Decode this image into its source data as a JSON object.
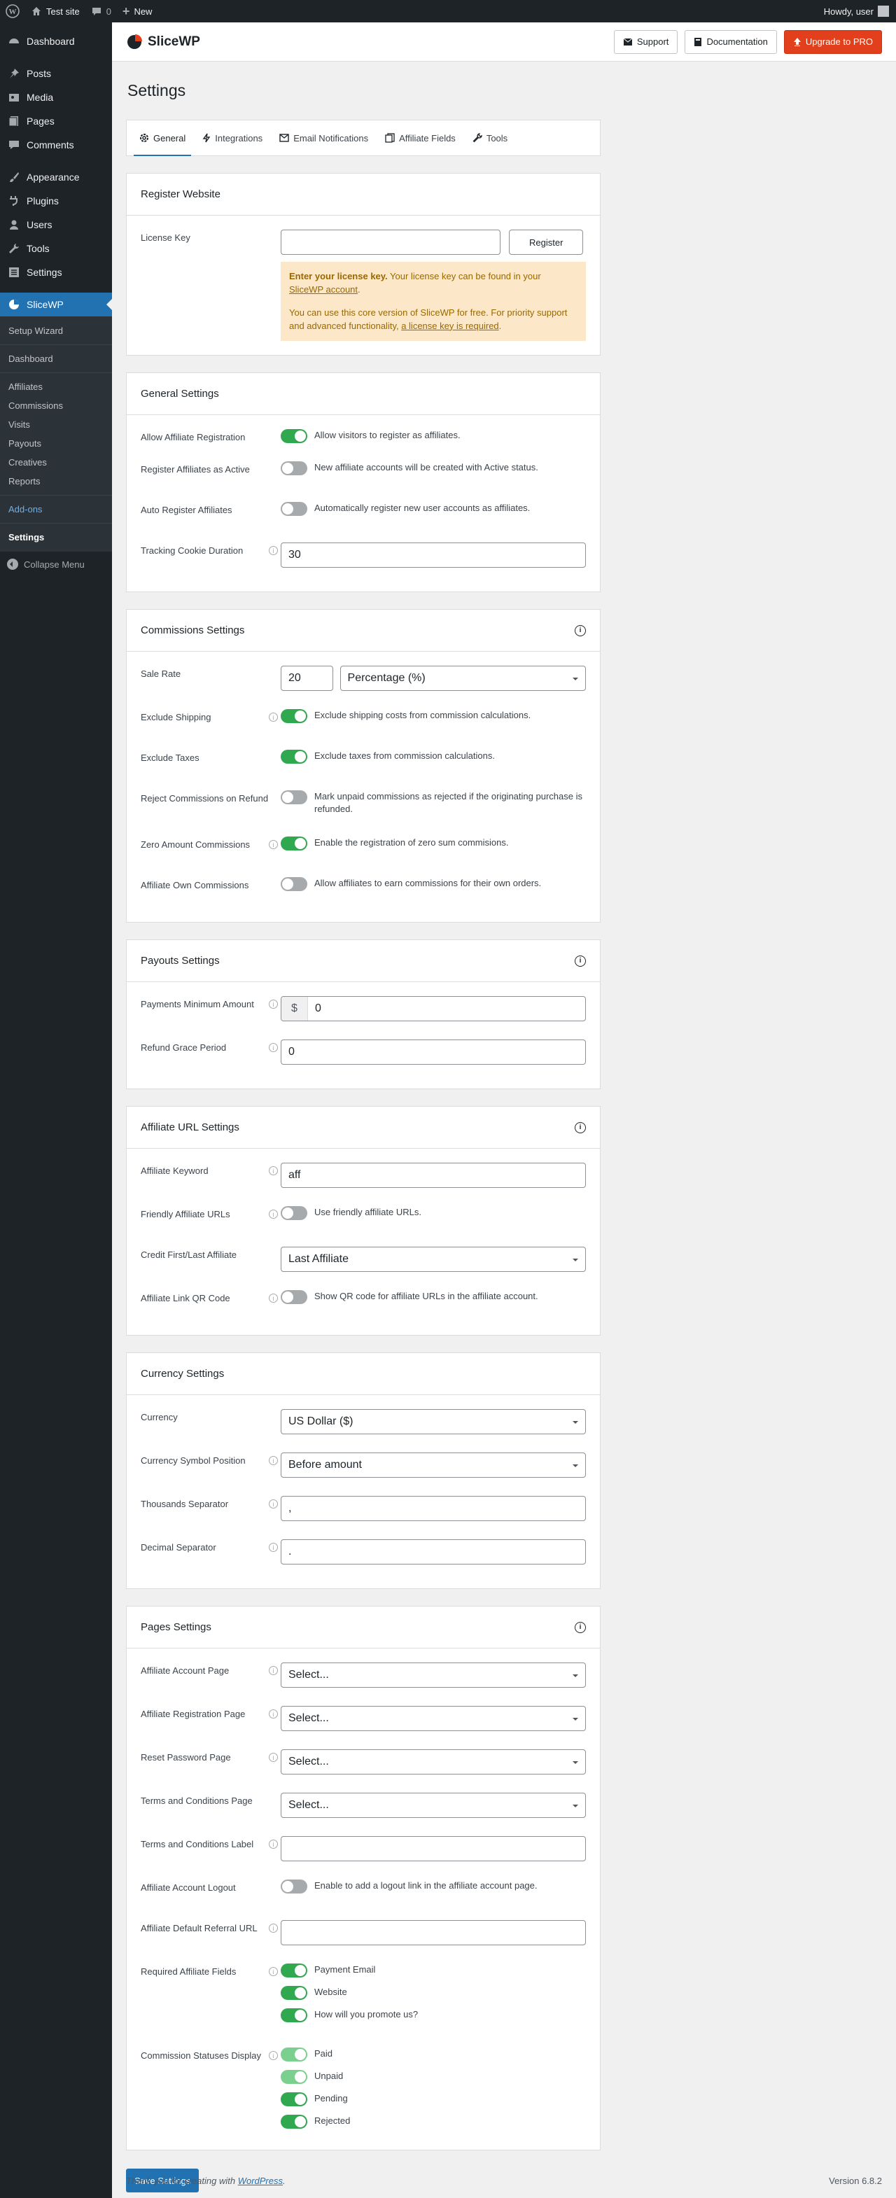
{
  "adminbar": {
    "site_name": "Test site",
    "comments_count": "0",
    "new_label": "New",
    "howdy": "Howdy, user"
  },
  "sidebar": {
    "items": [
      {
        "label": "Dashboard",
        "icon": "dashboard-icon"
      },
      {
        "label": "Posts",
        "icon": "pin-icon"
      },
      {
        "label": "Media",
        "icon": "media-icon"
      },
      {
        "label": "Pages",
        "icon": "pages-icon"
      },
      {
        "label": "Comments",
        "icon": "comment-icon"
      },
      {
        "label": "Appearance",
        "icon": "brush-icon"
      },
      {
        "label": "Plugins",
        "icon": "plug-icon"
      },
      {
        "label": "Users",
        "icon": "user-icon"
      },
      {
        "label": "Tools",
        "icon": "wrench-icon"
      },
      {
        "label": "Settings",
        "icon": "settings-icon"
      }
    ],
    "current": "SliceWP",
    "submenu": [
      "Setup Wizard",
      "Dashboard",
      "Affiliates",
      "Commissions",
      "Visits",
      "Payouts",
      "Creatives",
      "Reports",
      "Add-ons",
      "Settings"
    ],
    "collapse": "Collapse Menu"
  },
  "header": {
    "logo": "SliceWP",
    "support": "Support",
    "documentation": "Documentation",
    "upgrade": "Upgrade to PRO"
  },
  "page_title": "Settings",
  "tabs": [
    "General",
    "Integrations",
    "Email Notifications",
    "Affiliate Fields",
    "Tools"
  ],
  "register": {
    "title": "Register Website",
    "license_label": "License Key",
    "license_value": "",
    "register_btn": "Register",
    "notice_bold": "Enter your license key.",
    "notice_text1": " Your license key can be found in your ",
    "notice_link1": "SliceWP account",
    "notice_text1b": ".",
    "notice_text2": "You can use this core version of SliceWP for free. For priority support and advanced functionality, ",
    "notice_link2": "a license key is required",
    "notice_text2b": "."
  },
  "general": {
    "title": "General Settings",
    "allow_reg_label": "Allow Affiliate Registration",
    "allow_reg_text": "Allow visitors to register as affiliates.",
    "reg_active_label": "Register Affiliates as Active",
    "reg_active_text": "New affiliate accounts will be created with Active status.",
    "auto_reg_label": "Auto Register Affiliates",
    "auto_reg_text": "Automatically register new user accounts as affiliates.",
    "cookie_label": "Tracking Cookie Duration",
    "cookie_value": "30"
  },
  "commissions": {
    "title": "Commissions Settings",
    "sale_rate_label": "Sale Rate",
    "sale_rate_value": "20",
    "sale_rate_type": "Percentage (%)",
    "ship_label": "Exclude Shipping",
    "ship_text": "Exclude shipping costs from commission calculations.",
    "tax_label": "Exclude Taxes",
    "tax_text": "Exclude taxes from commission calculations.",
    "refund_label": "Reject Commissions on Refund",
    "refund_text": "Mark unpaid commissions as rejected if the originating purchase is refunded.",
    "zero_label": "Zero Amount Commissions",
    "zero_text": "Enable the registration of zero sum commisions.",
    "own_label": "Affiliate Own Commissions",
    "own_text": "Allow affiliates to earn commissions for their own orders."
  },
  "payouts": {
    "title": "Payouts Settings",
    "min_label": "Payments Minimum Amount",
    "min_prefix": "$",
    "min_value": "0",
    "grace_label": "Refund Grace Period",
    "grace_value": "0"
  },
  "url": {
    "title": "Affiliate URL Settings",
    "keyword_label": "Affiliate Keyword",
    "keyword_value": "aff",
    "friendly_label": "Friendly Affiliate URLs",
    "friendly_text": "Use friendly affiliate URLs.",
    "credit_label": "Credit First/Last Affiliate",
    "credit_value": "Last Affiliate",
    "qr_label": "Affiliate Link QR Code",
    "qr_text": "Show QR code for affiliate URLs in the affiliate account."
  },
  "currency": {
    "title": "Currency Settings",
    "currency_label": "Currency",
    "currency_value": "US Dollar ($)",
    "pos_label": "Currency Symbol Position",
    "pos_value": "Before amount",
    "thou_label": "Thousands Separator",
    "thou_value": ",",
    "dec_label": "Decimal Separator",
    "dec_value": "."
  },
  "pages": {
    "title": "Pages Settings",
    "account_label": "Affiliate Account Page",
    "account_value": "Select...",
    "registration_label": "Affiliate Registration Page",
    "registration_value": "Select...",
    "reset_label": "Reset Password Page",
    "reset_value": "Select...",
    "terms_label": "Terms and Conditions Page",
    "terms_value": "Select...",
    "terms_text_label": "Terms and Conditions Label",
    "terms_text_value": "",
    "logout_label": "Affiliate Account Logout",
    "logout_text": "Enable to add a logout link in the affiliate account page.",
    "default_url_label": "Affiliate Default Referral URL",
    "default_url_value": "",
    "required_label": "Required Affiliate Fields",
    "required_fields": [
      "Payment Email",
      "Website",
      "How will you promote us?"
    ],
    "statuses_label": "Commission Statuses Display",
    "statuses": [
      "Paid",
      "Unpaid",
      "Pending",
      "Rejected"
    ]
  },
  "save_btn": "Save Settings",
  "footer": {
    "thanks": "Thank you for creating with ",
    "wp_link": "WordPress",
    "thanks_end": ".",
    "version": "Version 6.8.2"
  },
  "colors": {
    "accent": "#2271b1",
    "toggle_on": "#2fa84f",
    "upgrade": "#e2401c",
    "notice_bg": "#fce8c8"
  }
}
